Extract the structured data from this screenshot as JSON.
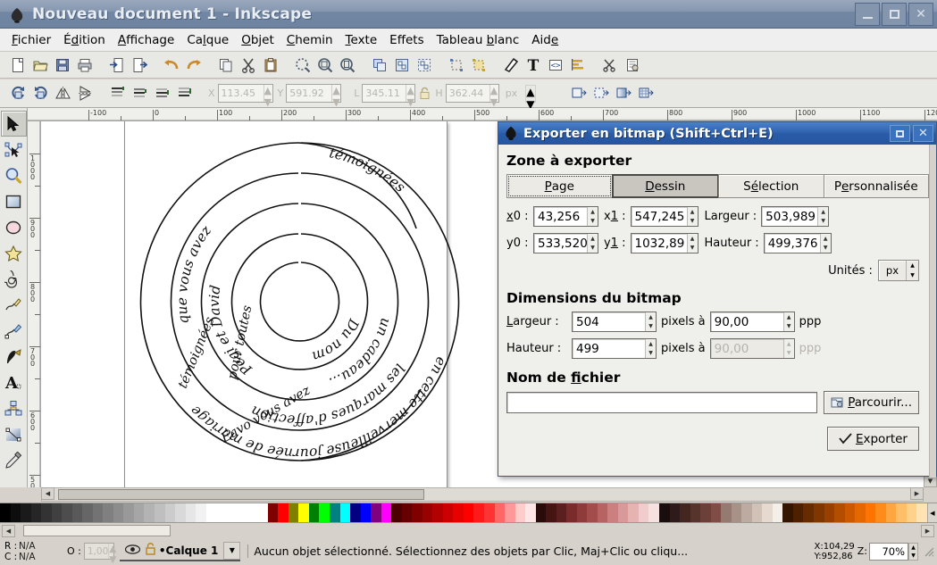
{
  "window": {
    "title": "Nouveau document 1 - Inkscape",
    "buttons": {
      "minimize": "_",
      "maximize": "□",
      "close": "✕"
    }
  },
  "menubar": {
    "items": [
      {
        "pre": "",
        "accel": "F",
        "post": "ichier"
      },
      {
        "pre": "É",
        "accel": "d",
        "post": "ition"
      },
      {
        "pre": "",
        "accel": "A",
        "post": "ffichage"
      },
      {
        "pre": "Ca",
        "accel": "l",
        "post": "que"
      },
      {
        "pre": "",
        "accel": "O",
        "post": "bjet"
      },
      {
        "pre": "",
        "accel": "C",
        "post": "hemin"
      },
      {
        "pre": "",
        "accel": "T",
        "post": "exte"
      },
      {
        "pre": "Effets",
        "accel": "",
        "post": ""
      },
      {
        "pre": "Tableau ",
        "accel": "b",
        "post": "lanc"
      },
      {
        "pre": "Aid",
        "accel": "e",
        "post": ""
      }
    ]
  },
  "toolbar_commands": {
    "icons": [
      "new-document-icon",
      "open-document-icon",
      "save-document-icon",
      "print-icon",
      "import-icon",
      "export-icon",
      "undo-icon",
      "redo-icon",
      "copy-icon",
      "cut-icon",
      "paste-icon",
      "zoom-selection-icon",
      "zoom-drawing-icon",
      "zoom-page-icon",
      "duplicate-icon",
      "group-icon",
      "ungroup-icon",
      "xml-editor-icon",
      "align-objects-icon",
      "fill-stroke-icon",
      "text-properties-icon",
      "xml-tree-icon",
      "align-distribute-icon",
      "preferences-icon",
      "document-properties-icon"
    ]
  },
  "toolbar_selector": {
    "icons": [
      "rotate-ccw-icon",
      "rotate-cw-icon",
      "flip-horizontal-icon",
      "flip-vertical-icon",
      "raise-to-top-icon",
      "raise-icon",
      "lower-icon",
      "lower-to-bottom-icon"
    ],
    "end_icons": [
      "transform-stroke-icon",
      "transform-corners-icon",
      "transform-gradients-icon",
      "transform-patterns-icon"
    ],
    "fields": [
      {
        "label": "X",
        "value": "113.45"
      },
      {
        "label": "Y",
        "value": "591.92"
      },
      {
        "label": "L",
        "value": "345.11"
      },
      {
        "label": "H",
        "value": "362.44"
      }
    ],
    "lock_icon": "lock-aspect-icon",
    "unit": "px"
  },
  "toolbox": {
    "tools": [
      {
        "name": "selector-tool",
        "active": true
      },
      {
        "name": "node-editor-tool",
        "active": false
      },
      {
        "name": "zoom-tool",
        "active": false
      },
      {
        "name": "rectangle-tool",
        "active": false
      },
      {
        "name": "ellipse-tool",
        "active": false
      },
      {
        "name": "star-tool",
        "active": false
      },
      {
        "name": "spiral-tool",
        "active": false
      },
      {
        "name": "pencil-tool",
        "active": false
      },
      {
        "name": "pen-tool",
        "active": false
      },
      {
        "name": "calligraphy-tool",
        "active": false
      },
      {
        "name": "text-tool",
        "active": false
      },
      {
        "name": "connector-tool",
        "active": false
      },
      {
        "name": "gradient-tool",
        "active": false
      },
      {
        "name": "dropper-tool",
        "active": false
      }
    ]
  },
  "rulers": {
    "horizontal": [
      "-100",
      "0",
      "100",
      "200",
      "300",
      "400",
      "500",
      "600",
      "700",
      "800",
      "900",
      "1000",
      "1100",
      "1200"
    ],
    "vertical": [
      "1000",
      "900",
      "800",
      "700",
      "600",
      "500"
    ]
  },
  "canvas": {
    "artwork_name": "spiral-text-artwork",
    "spiral_text": "Gâce vous avez témoignées en cette merveilleuse journée de mariage et pour toutes les marques d'affection que vous avez témoignées, un cadeau... Pegi et David Du nom"
  },
  "dialog": {
    "title": "Exporter en bitmap (Shift+Ctrl+E)",
    "icon": "inkscape-icon",
    "buttons": {
      "maximize": "□",
      "close": "✕"
    },
    "area": {
      "heading": "Zone à exporter",
      "tabs": [
        {
          "pre": "",
          "accel": "P",
          "post": "age",
          "active": false,
          "focus": true
        },
        {
          "pre": "",
          "accel": "D",
          "post": "essin",
          "active": true,
          "focus": false
        },
        {
          "pre": "S",
          "accel": "é",
          "post": "lection",
          "active": false,
          "focus": false
        },
        {
          "pre": "P",
          "accel": "e",
          "post": "rsonnalisée",
          "active": false,
          "focus": false
        }
      ],
      "fields": [
        {
          "label_pre": "",
          "label_accel": "x",
          "label_post": "0 :",
          "value": "43,256",
          "name": "x0-field"
        },
        {
          "label_pre": "x",
          "label_accel": "1",
          "label_post": " :",
          "value": "547,245",
          "name": "x1-field"
        },
        {
          "label_pre": "Largeur :",
          "label_accel": "",
          "label_post": "",
          "value": "503,989",
          "name": "area-width-field"
        },
        {
          "label_pre": "y0 :",
          "label_accel": "",
          "label_post": "",
          "value": "533,520",
          "name": "y0-field"
        },
        {
          "label_pre": "y",
          "label_accel": "1",
          "label_post": " :",
          "value": "1032,89",
          "name": "y1-field"
        },
        {
          "label_pre": "Hauteur :",
          "label_accel": "",
          "label_post": "",
          "value": "499,376",
          "name": "area-height-field"
        }
      ],
      "units_label": "Unités :",
      "units_value": "px"
    },
    "bitmap": {
      "heading": "Dimensions du bitmap",
      "width_label_pre": "",
      "width_label_accel": "L",
      "width_label_post": "argeur :",
      "width_value": "504",
      "width_mid": "pixels à",
      "width_dpi": "90,00",
      "width_unit": "ppp",
      "height_label": "Hauteur :",
      "height_value": "499",
      "height_mid": "pixels à",
      "height_dpi": "90,00",
      "height_unit": "ppp",
      "height_dpi_disabled": true
    },
    "filename": {
      "heading_pre": "Nom de ",
      "heading_accel": "fi",
      "heading_post": "chier",
      "value": "",
      "placeholder": "",
      "browse_pre": "",
      "browse_accel": "P",
      "browse_post": "arcourir...",
      "browse_icon": "folder-browse-icon"
    },
    "export": {
      "pre": "",
      "accel": "E",
      "post": "xporter",
      "icon": "check-icon"
    }
  },
  "statusbar": {
    "fill_label": "R :",
    "fill_value": "N/A",
    "stroke_label": "C :",
    "stroke_value": "N/A",
    "opacity_label": "O :",
    "opacity_value": "1,00",
    "eye_icon": "eye-icon",
    "lock_icon": "unlock-icon",
    "layer_name": "Calque 1",
    "message": "Aucun objet sélectionné. Sélectionnez des objets par Clic, Maj+Clic ou cliqu...",
    "coord_x_label": "X:",
    "coord_x": "104,29",
    "coord_y_label": "Y:",
    "coord_y": "952,86",
    "zoom_label": "Z:",
    "zoom_value": "70%"
  },
  "palette": {
    "colors": [
      "#000000",
      "#0d0d0d",
      "#1a1a1a",
      "#262626",
      "#333333",
      "#404040",
      "#4d4d4d",
      "#595959",
      "#666666",
      "#737373",
      "#808080",
      "#8c8c8c",
      "#999999",
      "#a6a6a6",
      "#b3b3b3",
      "#bfbfbf",
      "#cccccc",
      "#d9d9d9",
      "#e6e6e6",
      "#f2f2f2",
      "#ffffff",
      "#ffffff",
      "#ffffff",
      "#ffffff",
      "#ffffff",
      "#ffffff",
      "#800000",
      "#ff0000",
      "#808000",
      "#ffff00",
      "#008000",
      "#00ff00",
      "#008080",
      "#00ffff",
      "#000080",
      "#0000ff",
      "#800080",
      "#ff00ff",
      "#4d0000",
      "#660000",
      "#800000",
      "#990000",
      "#b30000",
      "#cc0000",
      "#e60000",
      "#ff0000",
      "#ff1a1a",
      "#ff3333",
      "#ff6666",
      "#ff9999",
      "#ffcccc",
      "#ffe6e6",
      "#2b0a0a",
      "#471414",
      "#5c1f1f",
      "#7a2b2b",
      "#8f3b3b",
      "#a34c4c",
      "#b86363",
      "#cc7f7f",
      "#d99999",
      "#e6b3b3",
      "#f0cccc",
      "#f7e0e0",
      "#1a0d0d",
      "#2e1a1a",
      "#42261f",
      "#56332b",
      "#6b4038",
      "#7f4d45",
      "#947a70",
      "#a89288",
      "#bdaaa0",
      "#d1c2b8",
      "#e6dad0",
      "#f5efe9",
      "#331500",
      "#4d2000",
      "#662b00",
      "#803600",
      "#994000",
      "#b34d00",
      "#cc5900",
      "#e66600",
      "#ff7300",
      "#ff8c1a",
      "#ffa640",
      "#ffbf66",
      "#ffd28c",
      "#ffe3b3"
    ]
  }
}
